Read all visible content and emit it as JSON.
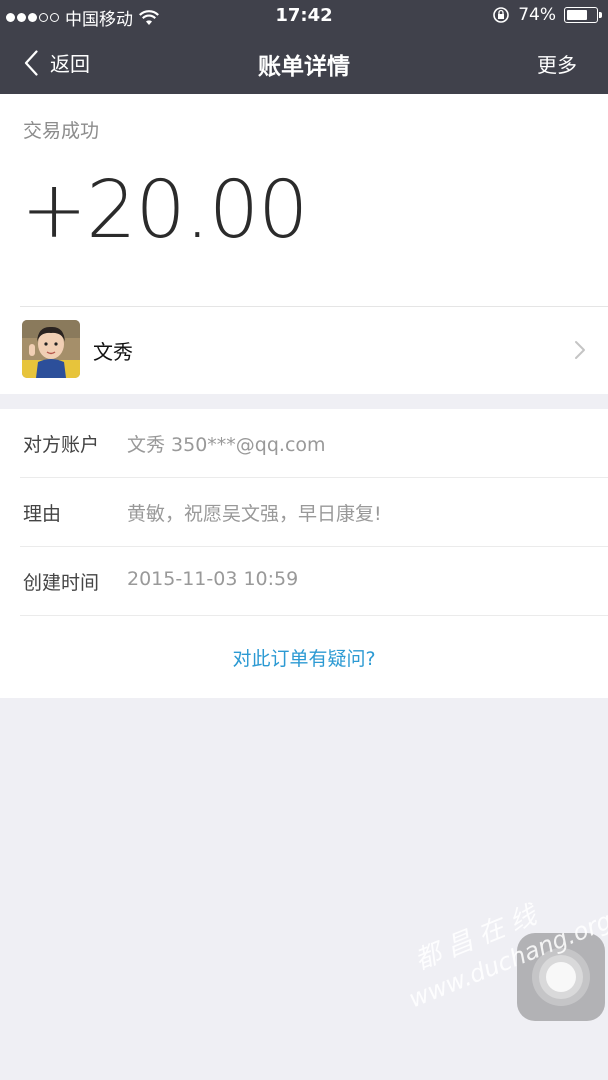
{
  "status_bar": {
    "carrier": "中国移动",
    "time": "17:42",
    "battery": "74%",
    "battery_level": 0.74,
    "signal_bars": 3,
    "signal_total": 5
  },
  "nav": {
    "back_label": "返回",
    "title": "账单详情",
    "more_label": "更多"
  },
  "transaction": {
    "status": "交易成功",
    "amount": "+20.00"
  },
  "payer": {
    "name": "文秀"
  },
  "details": [
    {
      "label": "对方账户",
      "value": "文秀 350***@qq.com"
    },
    {
      "label": "理由",
      "value": "黄敏，祝愿吴文强，早日康复!"
    },
    {
      "label": "创建时间",
      "value": "2015-11-03 10:59"
    }
  ],
  "question_link": "对此订单有疑问?",
  "watermark": {
    "text_cn": "都昌在线",
    "url": "www.duchang.org"
  },
  "colors": {
    "header_bg": "#40414b",
    "page_bg": "#efeff4",
    "link": "#2c9ad3"
  }
}
